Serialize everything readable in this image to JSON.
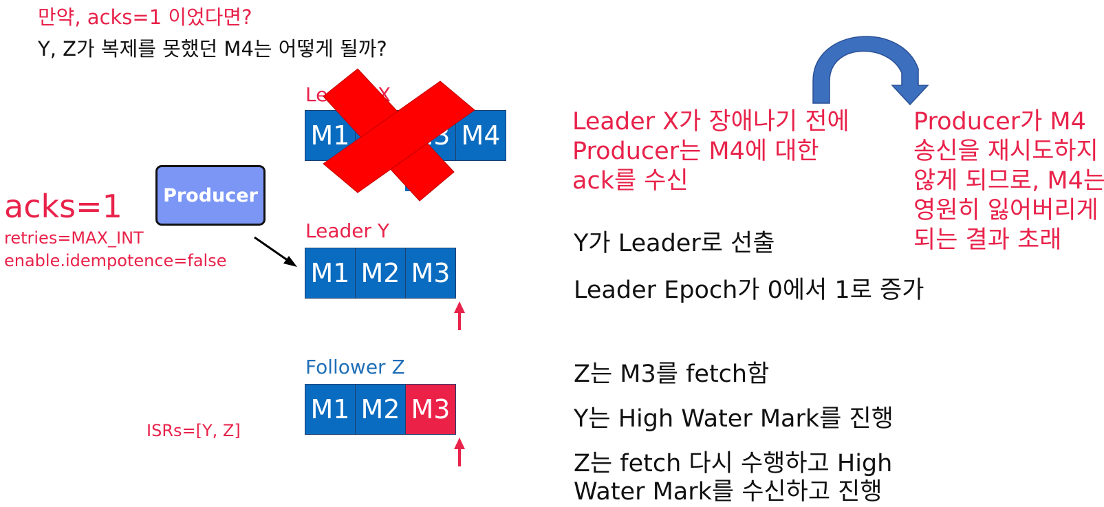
{
  "title": {
    "question1": "만약, acks=1 이었다면?",
    "question2": "Y, Z가 복제를 못했던 M4는 어떻게 될까?"
  },
  "config": {
    "acks": "acks=1",
    "retries": "retries=MAX_INT",
    "idempotence": "enable.idempotence=false",
    "isrs": "ISRs=[Y, Z]"
  },
  "producer": {
    "label": "Producer"
  },
  "leader_x": {
    "label": "Leader X",
    "messages": [
      "M1",
      "M2",
      "M3",
      "M4"
    ]
  },
  "leader_y": {
    "label": "Leader Y",
    "messages": [
      "M1",
      "M2",
      "M3"
    ]
  },
  "follower_z": {
    "label": "Follower Z",
    "messages": [
      "M1",
      "M2",
      "M3"
    ]
  },
  "notes": {
    "ack_received_lines": [
      "Leader X가 장애나기 전에",
      "Producer는 M4에 대한",
      "ack를 수신"
    ],
    "consequence_lines": [
      "Producer가 M4",
      "송신을 재시도하지",
      "않게 되므로, M4는",
      "영원히 잃어버리게",
      "되는 결과 초래"
    ],
    "y_elected": "Y가 Leader로 선출",
    "epoch": "Leader Epoch가 0에서 1로 증가",
    "z_fetch": "Z는 M3를 fetch함",
    "y_hwm": "Y는 High Water Mark를 진행",
    "z_fetch_again_lines": [
      "Z는 fetch 다시 수행하고 High",
      "Water Mark를 수신하고 진행"
    ]
  },
  "colors": {
    "red_text": "#e8224a",
    "blue_cell": "#0a6cc0",
    "highlight_cell": "#ec2148",
    "producer_box": "#7b96f5",
    "cross": "#ff0000",
    "curved_arrow": "#3d6fbf"
  }
}
